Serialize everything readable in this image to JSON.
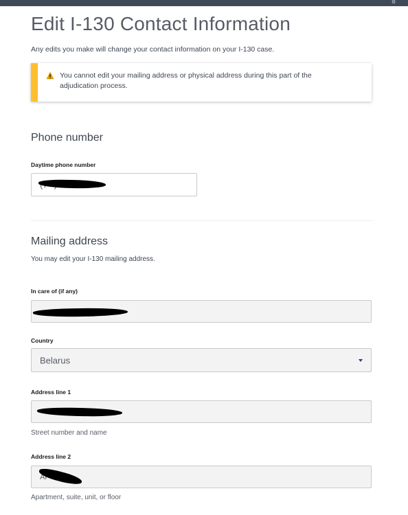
{
  "page": {
    "title": "Edit I-130 Contact Information",
    "subtitle": "Any edits you make will change your contact information on your I-130 case."
  },
  "alert": {
    "type": "warning",
    "icon": "warning-icon",
    "accent_color": "#ffbe2e",
    "message": "You cannot edit your mailing address or physical address during this part of the adjudication process."
  },
  "phone": {
    "heading": "Phone number",
    "daytime_label": "Daytime phone number",
    "daytime_value": "(7••) •••-•••8"
  },
  "mailing": {
    "heading": "Mailing address",
    "description": "You may edit your I-130 mailing address.",
    "in_care_of_label": "In care of (if any)",
    "country_label": "Country",
    "country_value": "Belarus",
    "address1_label": "Address line 1",
    "address1_hint": "Street number and name",
    "address2_label": "Address line 2",
    "address2_value": "AP",
    "address2_hint": "Apartment, suite, unit, or floor"
  }
}
